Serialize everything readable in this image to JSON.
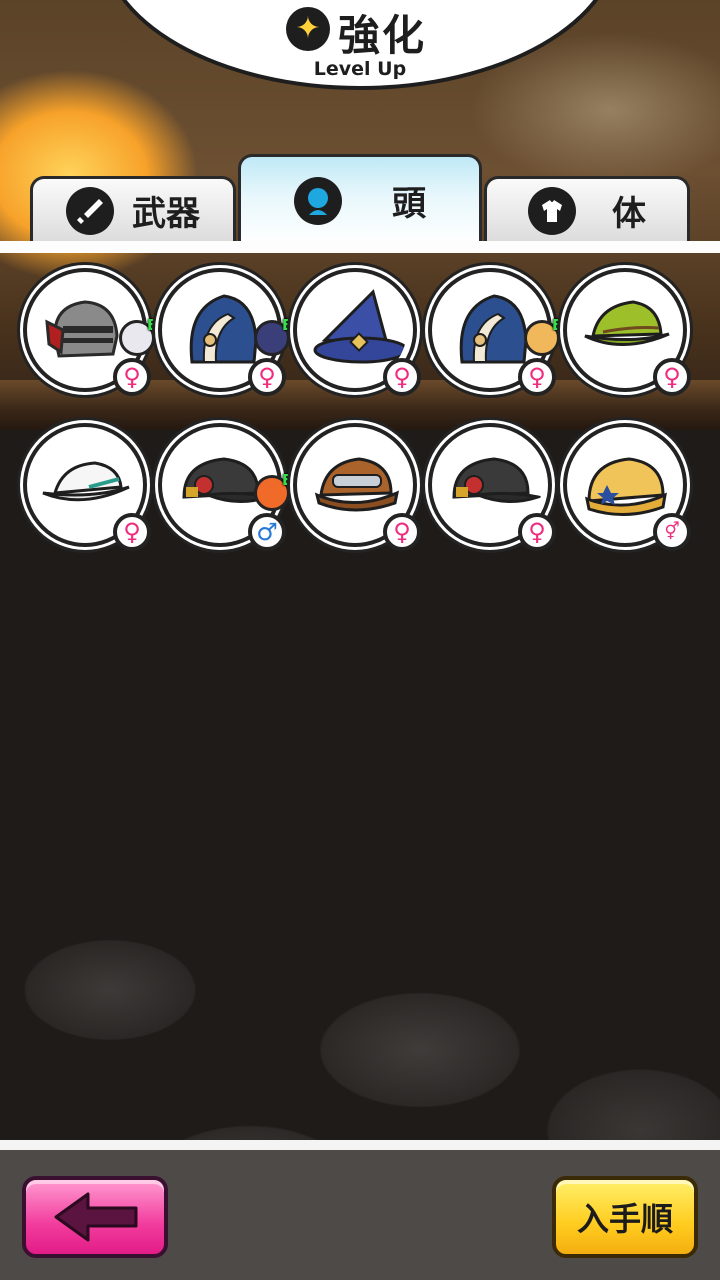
{
  "header": {
    "title": "強化",
    "subtitle": "Level Up",
    "icon": "sparkle-icon"
  },
  "tabs": [
    {
      "label": "武器",
      "icon": "sword-icon",
      "active": false
    },
    {
      "label": "頭",
      "icon": "head-icon",
      "active": true
    },
    {
      "label": "体",
      "icon": "shirt-icon",
      "active": false
    }
  ],
  "items": [
    {
      "name": "knight-helmet",
      "gender": "female",
      "equipped": true
    },
    {
      "name": "blue-hood",
      "gender": "female",
      "equipped": true
    },
    {
      "name": "wizard-hat",
      "gender": "female",
      "equipped": false
    },
    {
      "name": "blue-hood",
      "gender": "female",
      "equipped": true
    },
    {
      "name": "green-hat",
      "gender": "female",
      "equipped": false
    },
    {
      "name": "white-cap",
      "gender": "female",
      "equipped": false
    },
    {
      "name": "black-cap",
      "gender": "male",
      "equipped": true
    },
    {
      "name": "brown-goggle-cap",
      "gender": "female",
      "equipped": false
    },
    {
      "name": "black-cap",
      "gender": "female",
      "equipped": false
    },
    {
      "name": "yellow-knit-hat",
      "gender": "both",
      "equipped": false
    }
  ],
  "symbols": {
    "female": "♀",
    "male": "♂",
    "both": "⚥",
    "equipped": "E"
  },
  "buttons": {
    "back_icon": "left-arrow-icon",
    "sort_label": "入手順"
  },
  "colors": {
    "female": "#ef2c7e",
    "male": "#2478d6",
    "back_button": "#f23c9d",
    "sort_button": "#ffcc1f",
    "tab_active": "#bfe9f6"
  }
}
